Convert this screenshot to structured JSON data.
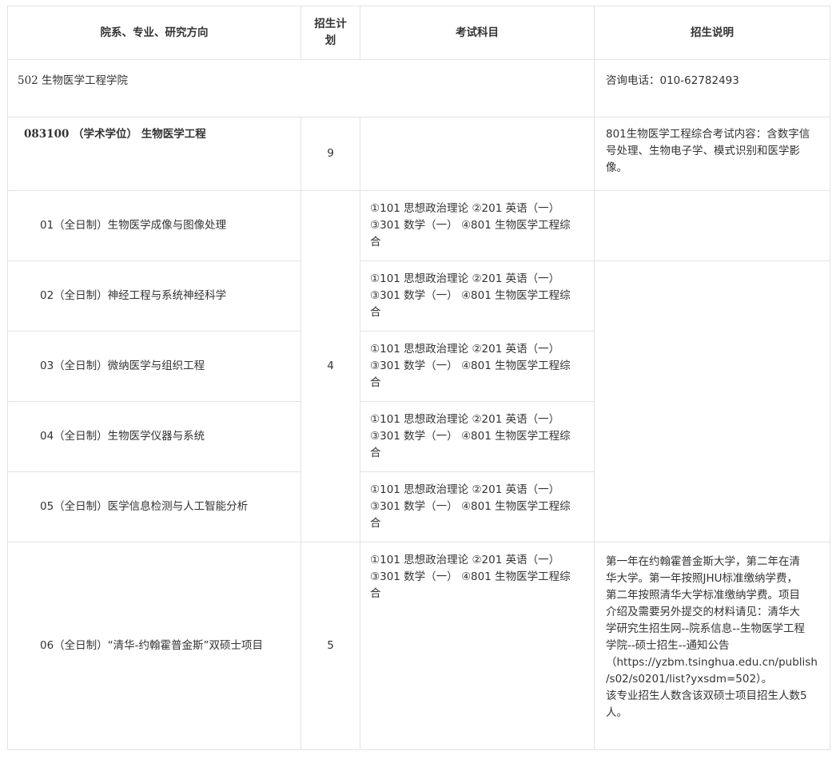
{
  "headers": {
    "department": "院系、专业、研究方向",
    "quota_line1": "招生计",
    "quota_line2": "划",
    "exam": "考试科目",
    "notes": "招生说明"
  },
  "department": {
    "name": "502  生物医学工程学院",
    "note": "咨询电话：010-62782493"
  },
  "major": {
    "name": "083100  （学术学位）  生物医学工程",
    "quota": "9",
    "note": "801生物医学工程综合考试内容：含数字信号处理、生物电子学、模式识别和医学影像。"
  },
  "directions": [
    {
      "name": "01（全日制）生物医学成像与图像处理",
      "exam_line1": "①101 思想政治理论 ②201 英语（一）",
      "exam_line2": "③301 数学（一） ④801 生物医学工程综",
      "exam_line3": "合"
    },
    {
      "name": "02（全日制）神经工程与系统神经科学",
      "exam_line1": "①101 思想政治理论 ②201 英语（一）",
      "exam_line2": "③301 数学（一） ④801 生物医学工程综",
      "exam_line3": "合"
    },
    {
      "name": "03（全日制）微纳医学与组织工程",
      "exam_line1": "①101 思想政治理论 ②201 英语（一）",
      "exam_line2": "③301 数学（一） ④801 生物医学工程综",
      "exam_line3": "合"
    },
    {
      "name": "04（全日制）生物医学仪器与系统",
      "exam_line1": "①101 思想政治理论 ②201 英语（一）",
      "exam_line2": "③301 数学（一） ④801 生物医学工程综",
      "exam_line3": "合"
    },
    {
      "name": "05（全日制）医学信息检测与人工智能分析",
      "exam_line1": "①101 思想政治理论 ②201 英语（一）",
      "exam_line2": "③301 数学（一） ④801 生物医学工程综",
      "exam_line3": "合"
    },
    {
      "name": "06（全日制）“清华-约翰霍普金斯”双硕士项目",
      "exam_line1": "①101 思想政治理论 ②201 英语（一）",
      "exam_line2": "③301 数学（一） ④801 生物医学工程综",
      "exam_line3": "合"
    }
  ],
  "quota_01_05": "4",
  "quota_06": "5",
  "note_06": {
    "line1": "第一年在约翰霍普金斯大学，第二年在清",
    "line2": "华大学。第一年按照JHU标准缴纳学费，",
    "line3": "第二年按照清华大学标准缴纳学费。项目",
    "line4": "介绍及需要另外提交的材料请见：清华大",
    "line5": "学研究生招生网--院系信息--生物医学工程",
    "line6": "学院--硕士招生--通知公告",
    "line7": "（https://yzbm.tsinghua.edu.cn/publish",
    "line8": "/s02/s0201/list?yxsdm=502）。",
    "line9": "该专业招生人数含该双硕士项目招生人数5",
    "line10": "人。"
  }
}
